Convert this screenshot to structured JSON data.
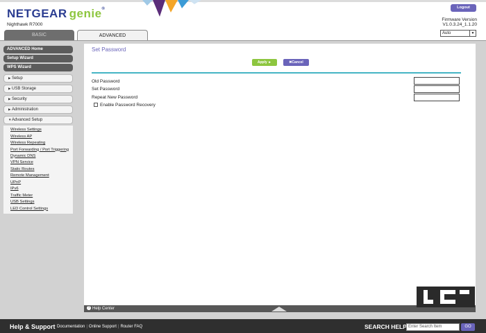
{
  "header": {
    "brand": "NETGEAR",
    "brand_sub": "genie",
    "trademark": "®",
    "model": "Nighthawk R7000",
    "logout_label": "Logout",
    "firmware_label": "Firmware Version",
    "firmware_value": "V1.0.3.24_1.1.20",
    "language_value": "Auto",
    "tabs": [
      {
        "label": "BASIC"
      },
      {
        "label": "ADVANCED"
      }
    ]
  },
  "sidebar": {
    "primary": [
      {
        "label": "ADVANCED Home"
      },
      {
        "label": "Setup Wizard"
      },
      {
        "label": "WPS Wizard"
      }
    ],
    "sections": [
      {
        "label": "Setup"
      },
      {
        "label": "USB Storage"
      },
      {
        "label": "Security"
      },
      {
        "label": "Administration"
      },
      {
        "label": "Advanced Setup"
      }
    ],
    "advanced_links": [
      {
        "label": "Wireless Settings"
      },
      {
        "label": "Wireless AP"
      },
      {
        "label": "Wireless Repeating"
      },
      {
        "label": "Port Forwarding / Port Triggering"
      },
      {
        "label": "Dynamic DNS"
      },
      {
        "label": "VPN Service"
      },
      {
        "label": "Static Routes"
      },
      {
        "label": "Remote Management"
      },
      {
        "label": "UPnP"
      },
      {
        "label": "IPv6"
      },
      {
        "label": "Traffic Meter"
      },
      {
        "label": "USB Settings"
      },
      {
        "label": "LED Control Settings"
      }
    ]
  },
  "main": {
    "title": "Set Password",
    "apply_label": "Apply ►",
    "cancel_label": "✖Cancel",
    "fields": [
      {
        "label": "Old Password",
        "value": ""
      },
      {
        "label": "Set Password",
        "value": ""
      },
      {
        "label": "Repeat New Password",
        "value": ""
      }
    ],
    "recovery_label": "Enable Password Recovery",
    "recovery_checked": false
  },
  "help_center": {
    "label": "Help Center"
  },
  "footer": {
    "title": "Help & Support",
    "links": [
      {
        "label": "Documentation"
      },
      {
        "label": "Online Support"
      },
      {
        "label": "Router FAQ"
      }
    ],
    "search_title": "SEARCH HELP",
    "search_placeholder": "Enter Search Item",
    "go_label": "GO"
  },
  "colors": {
    "brand_blue": "#2b3d91",
    "genie_green": "#8dc63f",
    "accent_purple": "#6a64ba",
    "rule_teal": "#44b4c4"
  }
}
